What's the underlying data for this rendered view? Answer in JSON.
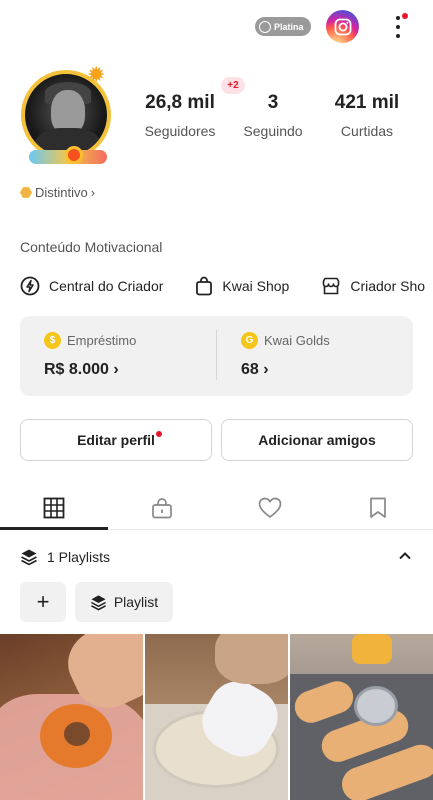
{
  "header": {
    "tier_label": "Platina",
    "instagram_icon": "instagram-icon",
    "more_icon": "more-vertical-icon"
  },
  "profile": {
    "new_followers_badge": "+2",
    "stats": [
      {
        "value": "26,8 mil",
        "label": "Seguidores"
      },
      {
        "value": "3",
        "label": "Seguindo"
      },
      {
        "value": "421 mil",
        "label": "Curtidas"
      }
    ],
    "distintivo": "Distintivo",
    "distintivo_arrow": "›",
    "bio": "Conteúdo Motivacional"
  },
  "links": [
    {
      "label": "Central do Criador",
      "icon": "lightning-circle-icon"
    },
    {
      "label": "Kwai Shop",
      "icon": "shopping-bag-icon"
    },
    {
      "label": "Criador Sho",
      "icon": "store-icon"
    }
  ],
  "wallet": {
    "loan": {
      "title": "Empréstimo",
      "value": "R$ 8.000",
      "arrow": "›"
    },
    "golds": {
      "title": "Kwai Golds",
      "value": "68",
      "arrow": "›"
    }
  },
  "actions": {
    "edit_profile": "Editar perfil",
    "add_friends": "Adicionar amigos"
  },
  "tabs": [
    {
      "icon": "grid-icon",
      "active": true
    },
    {
      "icon": "lock-icon",
      "active": false
    },
    {
      "icon": "heart-icon",
      "active": false
    },
    {
      "icon": "bookmark-icon",
      "active": false
    }
  ],
  "playlists": {
    "title": "1 Playlists",
    "add_label": "+",
    "playlist_button": "Playlist"
  },
  "colors": {
    "accent_red": "#e8162c",
    "card_bg": "#f1f1f1",
    "gold": "#f5c518"
  }
}
